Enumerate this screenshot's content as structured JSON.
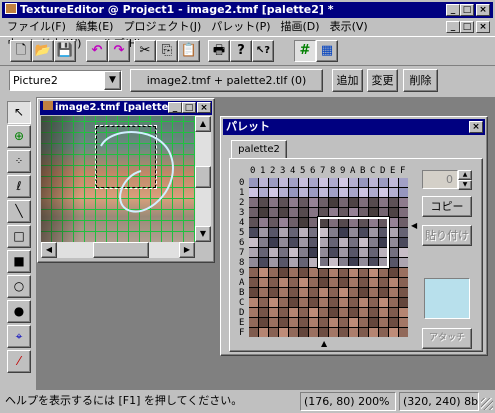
{
  "window": {
    "title": "TextureEditor @ Project1 - image2.tmf [palette2] *",
    "min": "_",
    "max": "□",
    "close": "×",
    "mdi_min": "_",
    "mdi_max": "□",
    "mdi_close": "×"
  },
  "menu": [
    "ファイル(F)",
    "編集(E)",
    "プロジェクト(J)",
    "パレット(P)",
    "描画(D)",
    "表示(V)",
    "ウィンドウ(W)",
    "ヘルプ(H)"
  ],
  "toolbar": [
    {
      "name": "new-icon",
      "glyph": "🗋"
    },
    {
      "name": "open-icon",
      "glyph": "📂"
    },
    {
      "name": "save-icon",
      "glyph": "💾"
    },
    {
      "name": "undo-icon",
      "glyph": "↶"
    },
    {
      "name": "redo-icon",
      "glyph": "↷"
    },
    {
      "name": "cut-icon",
      "glyph": "✂"
    },
    {
      "name": "copy-icon",
      "glyph": "⎘"
    },
    {
      "name": "paste-icon",
      "glyph": "📋"
    },
    {
      "name": "print-icon",
      "glyph": "🖶"
    },
    {
      "name": "help-icon",
      "glyph": "?"
    },
    {
      "name": "context-help-icon",
      "glyph": "↖?"
    },
    {
      "name": "grid-icon",
      "glyph": "#"
    },
    {
      "name": "palette-view-icon",
      "glyph": "▦"
    }
  ],
  "picture_select": {
    "value": "Picture2"
  },
  "image_label": "image2.tmf + palette2.tlf (0)",
  "buttons": {
    "add": "追加",
    "change": "変更",
    "delete": "削除"
  },
  "tools": [
    "select-arrow-icon",
    "zoom-icon",
    "spray-icon",
    "lasso-icon",
    "line-icon",
    "rectangle-icon",
    "filled-rectangle-icon",
    "ellipse-icon",
    "filled-ellipse-icon",
    "fill-icon",
    "eyedropper-icon"
  ],
  "image_window": {
    "title": "image2.tmf [palette2]"
  },
  "palette_window": {
    "title": "パレット",
    "close": "×",
    "tab": "palette2",
    "col_labels": [
      "0",
      "1",
      "2",
      "3",
      "4",
      "5",
      "6",
      "7",
      "8",
      "9",
      "A",
      "B",
      "C",
      "D",
      "E",
      "F"
    ],
    "row_labels": [
      "0",
      "1",
      "2",
      "3",
      "4",
      "5",
      "6",
      "7",
      "8",
      "9",
      "A",
      "B",
      "C",
      "D",
      "E",
      "F"
    ],
    "spin_value": "0",
    "copy": "コピー",
    "paste": "貼り付け",
    "attach": "アタッチ",
    "selected_color": "#b8e0ec"
  },
  "status": {
    "help": "ヘルプを表示するには [F1] を押してください。",
    "pos": "(176, 80) 200%",
    "size": "(320, 240) 8bi"
  }
}
